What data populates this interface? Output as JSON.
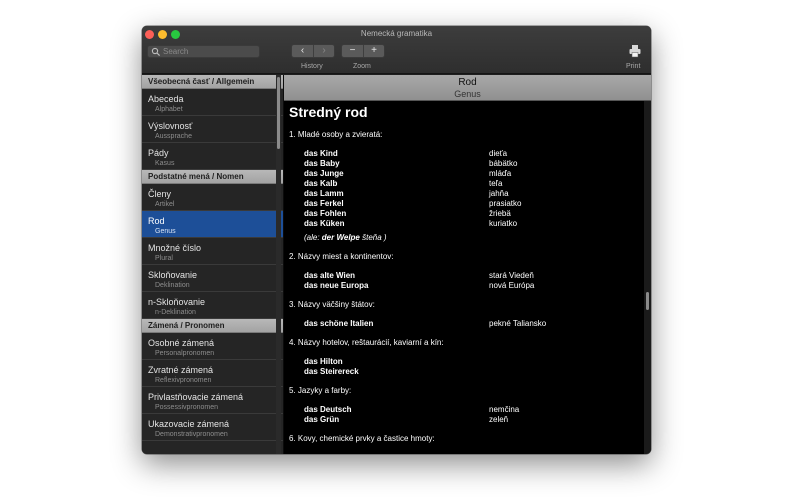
{
  "window": {
    "title": "Nemecká gramatika"
  },
  "toolbar": {
    "search_placeholder": "Search",
    "history_label": "History",
    "zoom_label": "Zoom",
    "print_label": "Print",
    "back_glyph": "‹",
    "forward_glyph": "›",
    "zoom_out_glyph": "−",
    "zoom_in_glyph": "+"
  },
  "sidebar": {
    "sections": [
      {
        "title": "Všeobecná časť / Allgemein",
        "items": [
          {
            "label": "Abeceda",
            "sublabel": "Alphabet"
          },
          {
            "label": "Výslovnosť",
            "sublabel": "Aussprache"
          },
          {
            "label": "Pády",
            "sublabel": "Kasus"
          }
        ]
      },
      {
        "title": "Podstatné mená / Nomen",
        "items": [
          {
            "label": "Členy",
            "sublabel": "Artikel"
          },
          {
            "label": "Rod",
            "sublabel": "Genus",
            "selected": true
          },
          {
            "label": "Množné číslo",
            "sublabel": "Plural"
          },
          {
            "label": "Skloňovanie",
            "sublabel": "Deklination"
          },
          {
            "label": "n-Skloňovanie",
            "sublabel": "n-Deklination"
          }
        ]
      },
      {
        "title": "Zámená / Pronomen",
        "items": [
          {
            "label": "Osobné zámená",
            "sublabel": "Personalpronomen"
          },
          {
            "label": "Zvratné zámená",
            "sublabel": "Reflexivpronomen"
          },
          {
            "label": "Privlastňovacie zámená",
            "sublabel": "Possessivpronomen"
          },
          {
            "label": "Ukazovacie zámená",
            "sublabel": "Demonstrativpronomen"
          }
        ]
      }
    ]
  },
  "content": {
    "header_title": "Rod",
    "header_subtitle": "Genus",
    "heading": "Stredný rod",
    "groups": [
      {
        "title": "1. Mladé osoby a zvieratá:",
        "rows": [
          {
            "de": "das Kind",
            "sk": "dieťa"
          },
          {
            "de": "das Baby",
            "sk": "bábätko"
          },
          {
            "de": "das Junge",
            "sk": "mláďa"
          },
          {
            "de": "das Kalb",
            "sk": "teľa"
          },
          {
            "de": "das Lamm",
            "sk": "jahňa"
          },
          {
            "de": "das Ferkel",
            "sk": "prasiatko"
          },
          {
            "de": "das Fohlen",
            "sk": "žriebä"
          },
          {
            "de": "das Küken",
            "sk": "kuriatko"
          }
        ],
        "note": {
          "prefix": "(ale: ",
          "bold": "der Welpe",
          "suffix": " šteňa )"
        }
      },
      {
        "title": "2. Názvy miest a kontinentov:",
        "rows": [
          {
            "de": "das alte Wien",
            "sk": "stará Viedeň"
          },
          {
            "de": "das neue Europa",
            "sk": "nová Európa"
          }
        ]
      },
      {
        "title": "3. Názvy väčšiny štátov:",
        "rows": [
          {
            "de": "das schöne Italien",
            "sk": "pekné Taliansko"
          }
        ]
      },
      {
        "title": "4. Názvy hotelov, reštaurácií, kaviarní a kín:",
        "rows": [
          {
            "de": "das Hilton",
            "sk": ""
          },
          {
            "de": "das Steirereck",
            "sk": ""
          }
        ]
      },
      {
        "title": "5. Jazyky a farby:",
        "rows": [
          {
            "de": "das Deutsch",
            "sk": "nemčina"
          },
          {
            "de": "das Grün",
            "sk": "zeleň"
          }
        ]
      },
      {
        "title": "6. Kovy, chemické prvky a častice hmoty:",
        "rows": []
      }
    ]
  }
}
